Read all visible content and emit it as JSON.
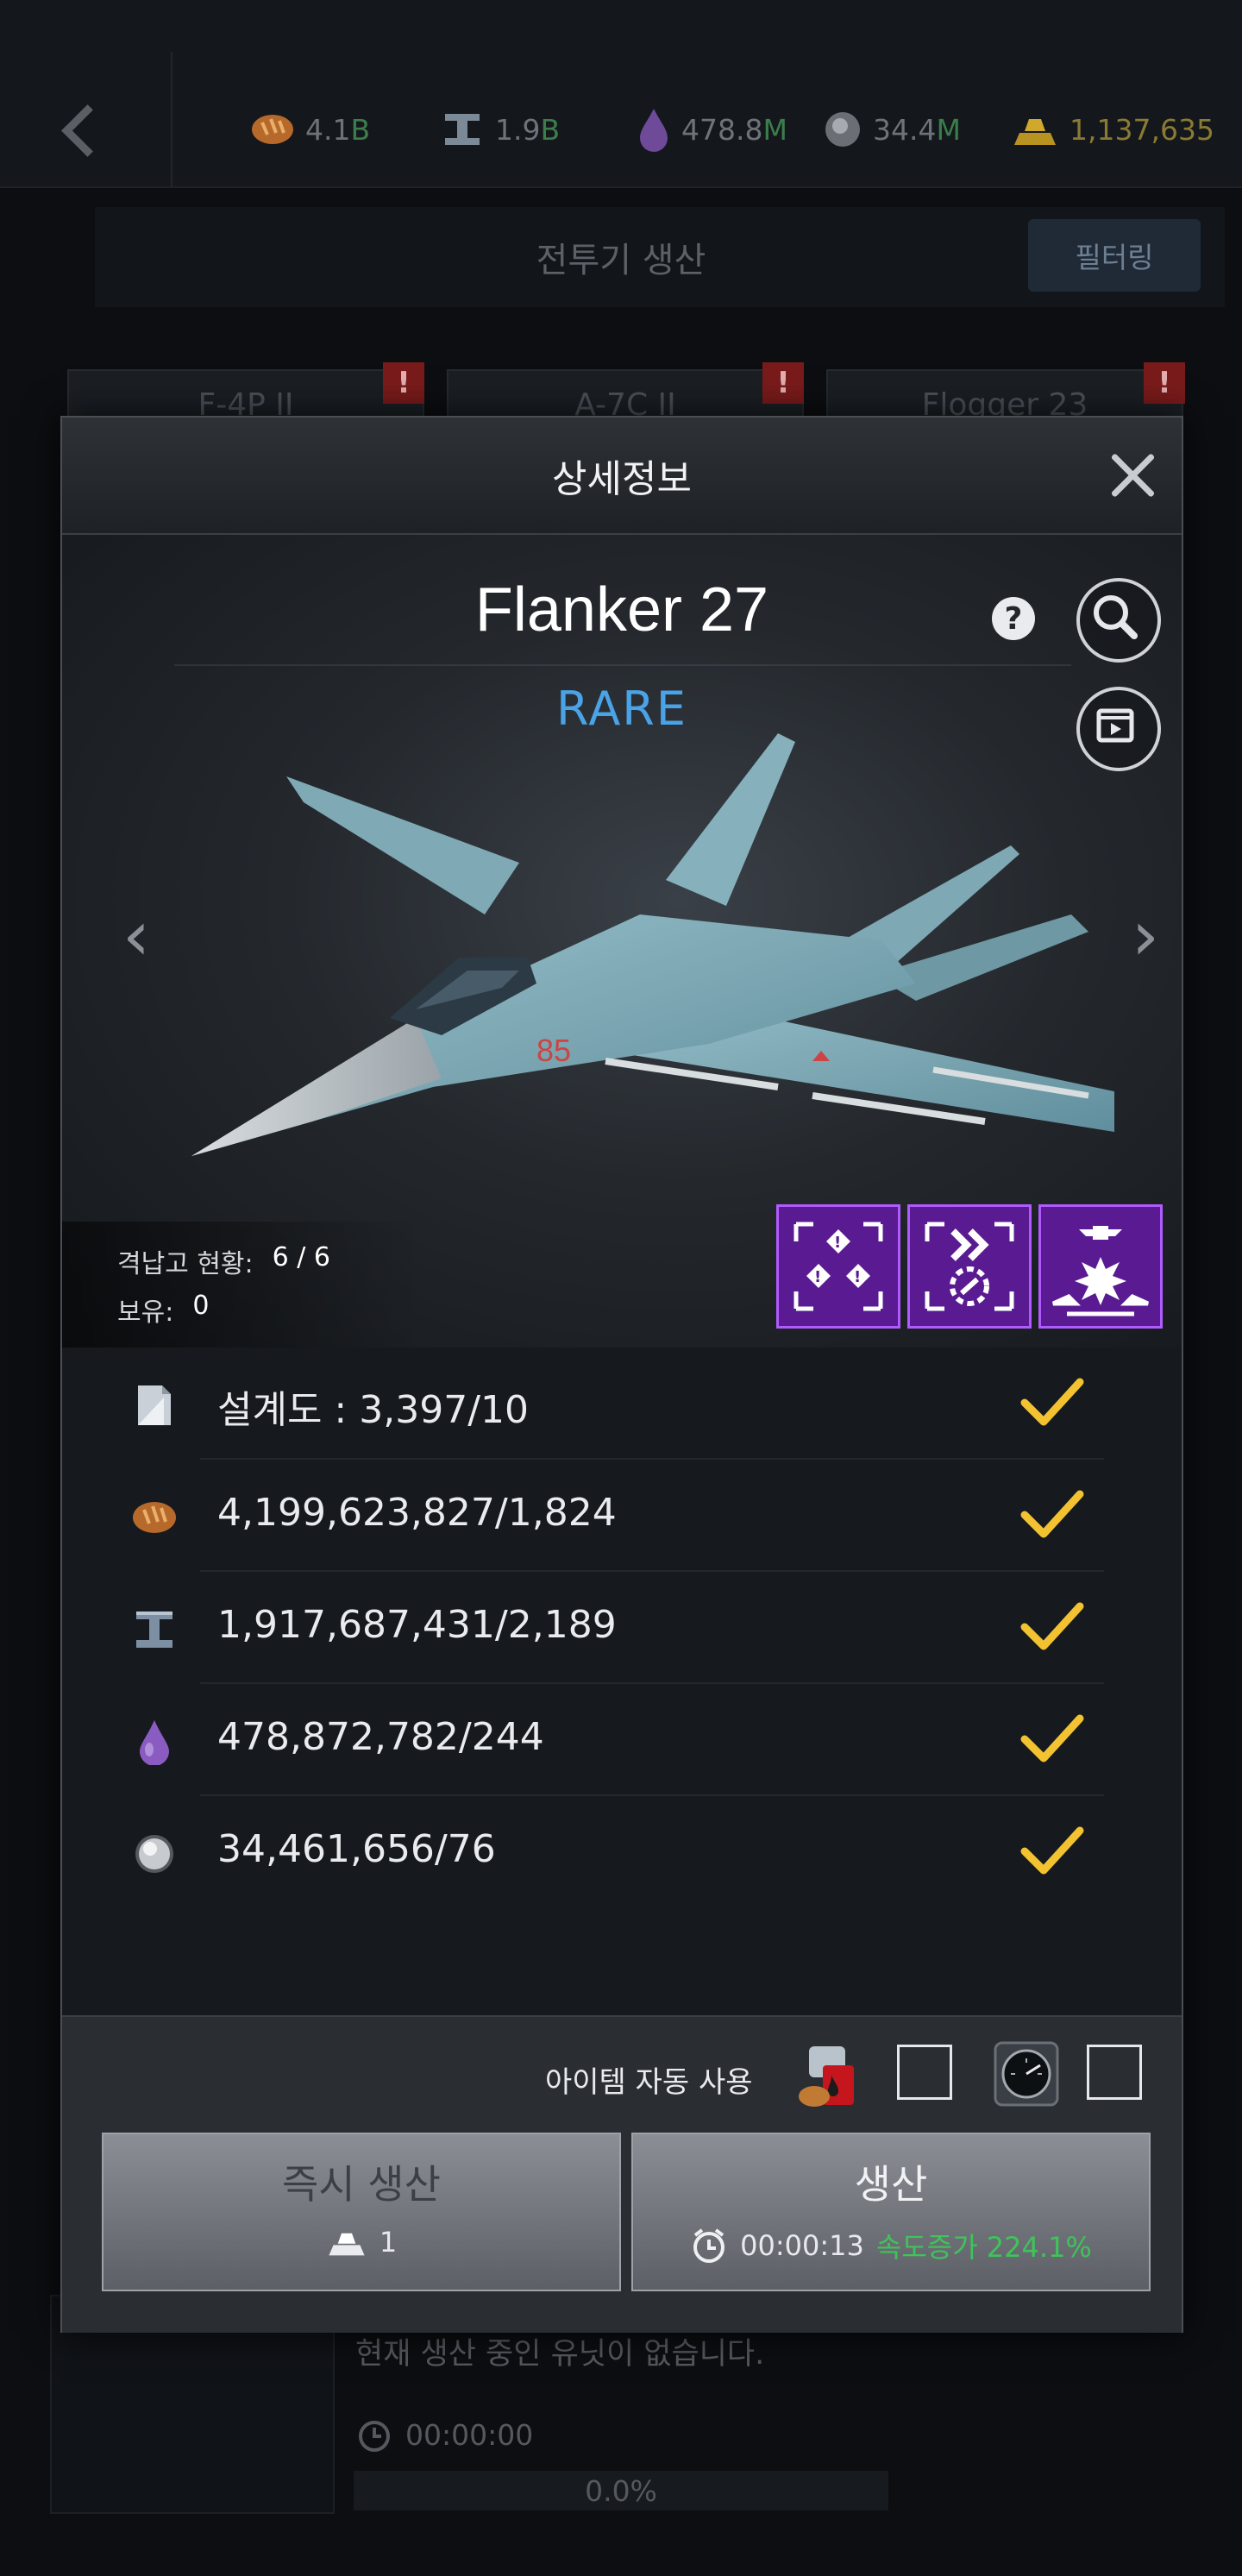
{
  "topbar": {
    "resources": [
      {
        "icon": "bread-icon",
        "value": "4.1",
        "unit": "B"
      },
      {
        "icon": "steel-icon",
        "value": "1.9",
        "unit": "B"
      },
      {
        "icon": "oil-icon",
        "value": "478.8",
        "unit": "M"
      },
      {
        "icon": "rare-metal-icon",
        "value": "34.4",
        "unit": "M"
      },
      {
        "icon": "gold-bars-icon",
        "value": "1,137,635",
        "unit": ""
      }
    ]
  },
  "screen": {
    "title": "전투기 생산",
    "filter_label": "필터링",
    "tabs": [
      "F-4P II",
      "A-7C II",
      "Flogger 23"
    ],
    "empty_message": "현재 생산 중인 유닛이 없습니다.",
    "timer": "00:00:00",
    "progress": "0.0%"
  },
  "modal": {
    "title": "상세정보",
    "unit_name": "Flanker 27",
    "rarity": "RARE",
    "status": {
      "destroyed_label": "격납고 현황:",
      "destroyed_value": "6 / 6",
      "owned_label": "보유:",
      "owned_value": "0"
    },
    "skills": [
      "warning-skill-icon",
      "speed-link-skill-icon",
      "air-strike-skill-icon"
    ],
    "requirements": [
      {
        "icon": "blueprint-icon",
        "text": "설계도 : 3,397/10",
        "met": true
      },
      {
        "icon": "bread-icon",
        "text": "4,199,623,827/1,824",
        "met": true
      },
      {
        "icon": "steel-icon",
        "text": "1,917,687,431/2,189",
        "met": true
      },
      {
        "icon": "oil-icon",
        "text": "478,872,782/244",
        "met": true
      },
      {
        "icon": "rare-metal-icon",
        "text": "34,461,656/76",
        "met": true
      }
    ],
    "footer": {
      "auto_use_label": "아이템 자동 사용",
      "instant_label": "즉시 생산",
      "instant_cost": "1",
      "produce_label": "생산",
      "produce_time": "00:00:13",
      "speed_text": "속도증가 224.1%"
    }
  },
  "colors": {
    "rarity": "#4aa3e6",
    "check": "#f2c230",
    "skill_bg": "#5a1b92",
    "speed": "#3fc35a"
  }
}
